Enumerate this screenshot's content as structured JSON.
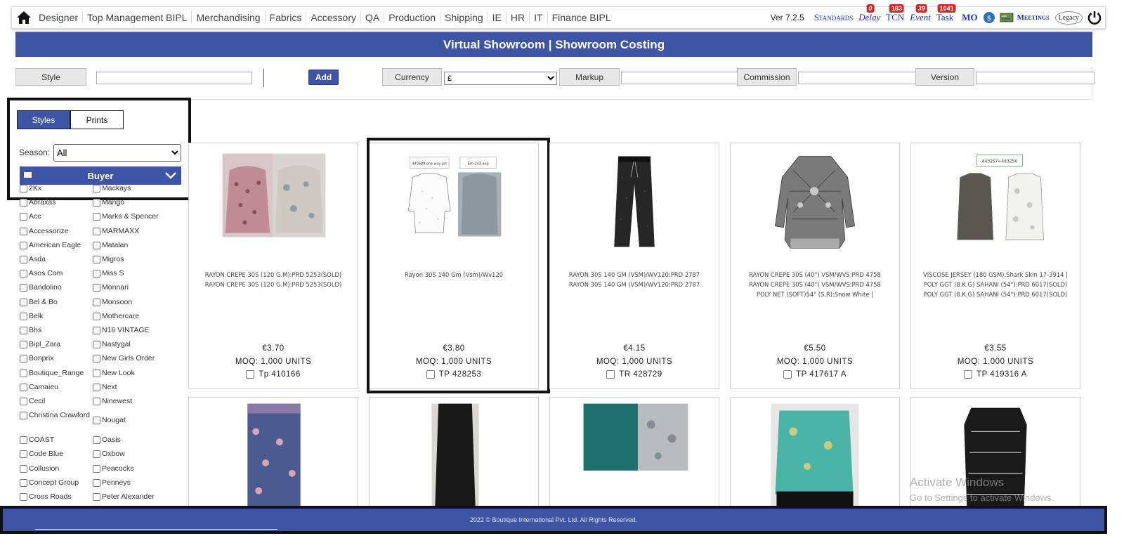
{
  "nav": {
    "items": [
      "Designer",
      "Top Management BIPL",
      "Merchandising",
      "Fabrics",
      "Accessory",
      "QA",
      "Production",
      "Shipping",
      "IE",
      "HR",
      "IT",
      "Finance BIPL"
    ],
    "version": "Ver 7.2.5",
    "standards": "Standards",
    "delay": "Delay",
    "delay_count": "0",
    "tcn": "TCN",
    "tcn_count": "183",
    "event": "Event",
    "event_count": "39",
    "task": "Task",
    "task_count": "1041",
    "mo": "MO",
    "meetings": "Meetings",
    "legacy": "Legacy"
  },
  "title": "Virtual Showroom | Showroom Costing",
  "filters": {
    "style_label": "Style",
    "add_label": "Add",
    "currency_label": "Currency",
    "currency_value": "£",
    "markup_label": "Markup",
    "commission_label": "Commission",
    "version_label": "Version"
  },
  "sidebar": {
    "tab_styles": "Styles",
    "tab_prints": "Prints",
    "season_label": "Season:",
    "season_value": "All",
    "buyer_header": "Buyer",
    "buyers_left": [
      "2Kx",
      "Abraxas",
      "Acc",
      "Accessorize",
      "American Eagle",
      "Asda",
      "Asos.Com",
      "Bandolino",
      "Bel & Bo",
      "Belk",
      "Bhs",
      "Bipl_Zara",
      "Bonprix",
      "Boutique_Range",
      "Camaieu",
      "Cecil",
      "Christina Crawford",
      "COAST",
      "Code Blue",
      "Collusion",
      "Concept Group",
      "Cross Roads"
    ],
    "buyers_right": [
      "Mackays",
      "Mango",
      "Marks & Spencer",
      "MARMAXX",
      "Matalan",
      "Migros",
      "Miss S",
      "Monnari",
      "Monsoon",
      "Mothercare",
      "N16 VINTAGE",
      "Nastygal",
      "New Girls Order",
      "New Look",
      "Next",
      "Ninewest",
      "Nougat",
      "Oasis",
      "Oxbow",
      "Peacocks",
      "Penneys",
      "Peter Alexander"
    ]
  },
  "products": [
    {
      "desc": [
        "RAYON CREPE 30S (120 G.M):PRD 5253(SOLD)",
        "RAYON CREPE 30S (120 G.M):PRD 5253(SOLD)"
      ],
      "price": "€3.70",
      "moq": "MOQ: 1,000 UNITS",
      "code": "Tp 410166"
    },
    {
      "desc": [
        "Rayon 30S 140 Gm (Vsm)/Wv120"
      ],
      "price": "€3.80",
      "moq": "MOQ: 1,000 UNITS",
      "code": "TP 428253",
      "tag1": "440689 one way prt",
      "tag2": "Ern 243 aop"
    },
    {
      "desc": [
        "RAYON 30S 140 GM (VSM)/WV120:PRD 2787",
        "RAYON 30S 140 GM (VSM)/WV120:PRD 2787"
      ],
      "price": "€4.15",
      "moq": "MOQ: 1,000 UNITS",
      "code": "TR 428729"
    },
    {
      "desc": [
        "RAYON CREPE 30S (40\") VSM/WVS:PRD 4758",
        "RAYON CREPE 30S (40\") VSM/WVS:PRD 4758",
        "POLY NET (SOFT)54\" (S.R):Snow White |"
      ],
      "price": "€5.50",
      "moq": "MOQ: 1,000 UNITS",
      "code": "TP 417617 A"
    },
    {
      "desc": [
        "VISCOSE JERSEY (180 GSM):Shark Skin 17-3914 |",
        "POLY GGT (8.K.G) SAHANI (54\"):PRD 6017(SOLD)",
        "POLY GGT (8.K.G) SAHANI (54\"):PRD 6017(SOLD)"
      ],
      "price": "€3.55",
      "moq": "MOQ: 1,000 UNITS",
      "code": "TP 419316 A",
      "tag1": "443257+443256"
    }
  ],
  "watermark": {
    "line1": "Activate Windows",
    "line2": "Go to Settings to activate Windows."
  },
  "footer": "2022 © Boutique International Pvt. Ltd. All Rights Reserved.",
  "colors": {
    "brand": "#3d55a4",
    "badge": "#d72424",
    "link": "#1a32c8"
  }
}
